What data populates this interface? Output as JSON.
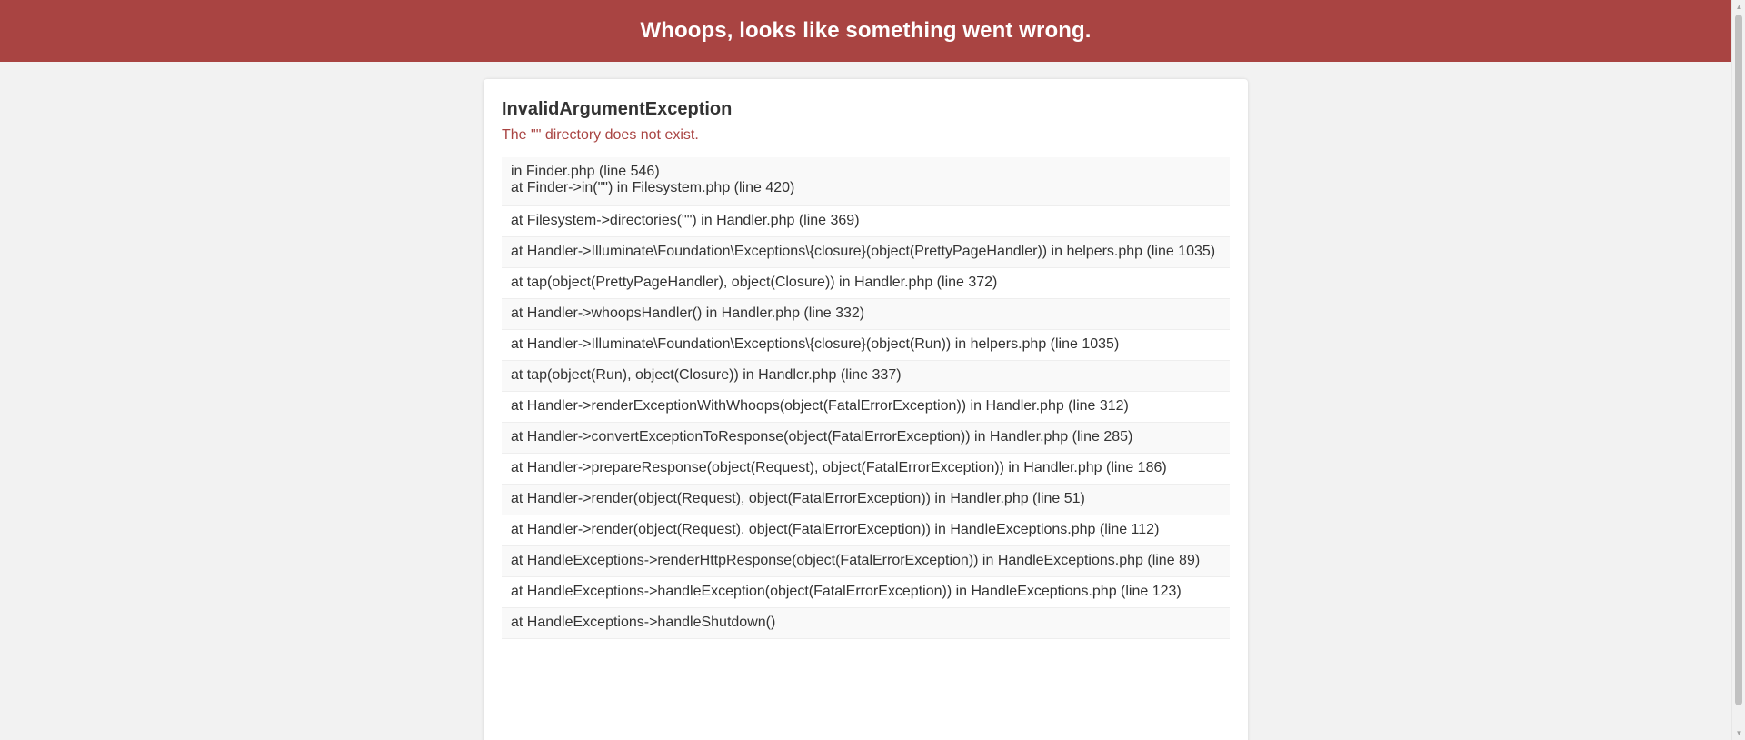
{
  "header": {
    "title": "Whoops, looks like something went wrong."
  },
  "exception": {
    "name": "InvalidArgumentException",
    "message": "The \"\" directory does not exist."
  },
  "trace": {
    "first": {
      "line1": "in Finder.php (line 546)",
      "line2": "at Finder->in(\"\") in Filesystem.php (line 420)"
    },
    "items": [
      "at Filesystem->directories(\"\") in Handler.php (line 369)",
      "at Handler->Illuminate\\Foundation\\Exceptions\\{closure}(object(PrettyPageHandler)) in helpers.php (line 1035)",
      "at tap(object(PrettyPageHandler), object(Closure)) in Handler.php (line 372)",
      "at Handler->whoopsHandler() in Handler.php (line 332)",
      "at Handler->Illuminate\\Foundation\\Exceptions\\{closure}(object(Run)) in helpers.php (line 1035)",
      "at tap(object(Run), object(Closure)) in Handler.php (line 337)",
      "at Handler->renderExceptionWithWhoops(object(FatalErrorException)) in Handler.php (line 312)",
      "at Handler->convertExceptionToResponse(object(FatalErrorException)) in Handler.php (line 285)",
      "at Handler->prepareResponse(object(Request), object(FatalErrorException)) in Handler.php (line 186)",
      "at Handler->render(object(Request), object(FatalErrorException)) in Handler.php (line 51)",
      "at Handler->render(object(Request), object(FatalErrorException)) in HandleExceptions.php (line 112)",
      "at HandleExceptions->renderHttpResponse(object(FatalErrorException)) in HandleExceptions.php (line 89)",
      "at HandleExceptions->handleException(object(FatalErrorException)) in HandleExceptions.php (line 123)",
      "at HandleExceptions->handleShutdown()"
    ]
  },
  "colors": {
    "header_bg": "#a94442",
    "message_text": "#a94442",
    "page_bg": "#f2f2f2"
  },
  "scrollbar": {
    "up_icon": "scroll-up-arrow-icon",
    "down_icon": "scroll-down-arrow-icon"
  }
}
